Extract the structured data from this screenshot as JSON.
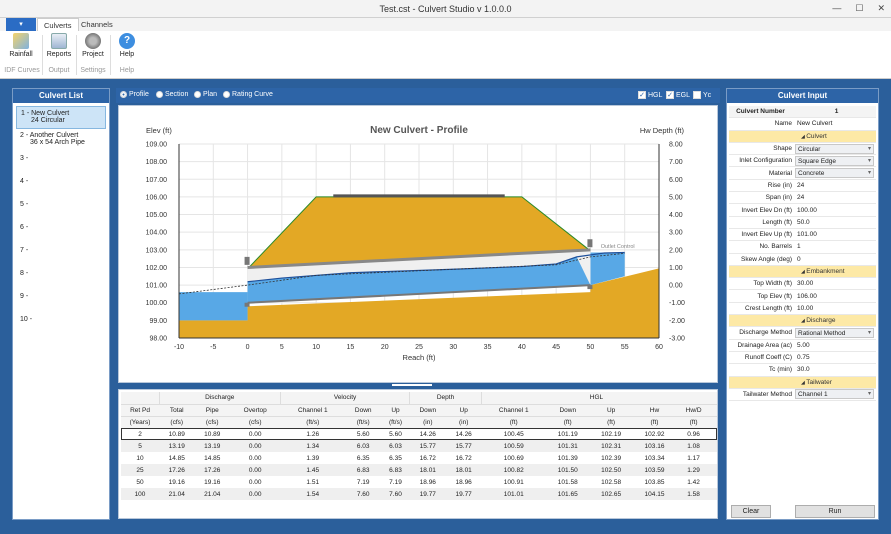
{
  "window": {
    "title": "Test.cst - Culvert Studio v 1.0.0.0"
  },
  "tabs": [
    "Culverts",
    "Channels"
  ],
  "ribbon": {
    "buttons": [
      {
        "label": "Rainfall",
        "icon": "rainfall-icon"
      },
      {
        "label": "Reports",
        "icon": "reports-icon"
      },
      {
        "label": "Project",
        "icon": "gears-icon"
      },
      {
        "label": "Help",
        "icon": "help-icon"
      }
    ],
    "groups": [
      "IDF Curves",
      "Output",
      "Settings",
      "Help"
    ]
  },
  "culvert_list": {
    "title": "Culvert List",
    "items": [
      {
        "line1": "1 - New Culvert",
        "line2": "24 Circular"
      },
      {
        "line1": "2 - Another Culvert",
        "line2": "36 x 54 Arch Pipe"
      },
      {
        "line1": "3 -",
        "line2": ""
      },
      {
        "line1": "4 -",
        "line2": ""
      },
      {
        "line1": "5 -",
        "line2": ""
      },
      {
        "line1": "6 -",
        "line2": ""
      },
      {
        "line1": "7 -",
        "line2": ""
      },
      {
        "line1": "8 -",
        "line2": ""
      },
      {
        "line1": "9 -",
        "line2": ""
      },
      {
        "line1": "10 -",
        "line2": ""
      }
    ]
  },
  "view_options": {
    "radios": [
      "Profile",
      "Section",
      "Plan",
      "Rating Curve"
    ],
    "selected": "Profile",
    "checks": [
      {
        "label": "HGL",
        "checked": true
      },
      {
        "label": "EGL",
        "checked": true
      },
      {
        "label": "Yc",
        "checked": false
      }
    ]
  },
  "chart_data": {
    "type": "area",
    "title": "New Culvert - Profile",
    "ylabel": "Elev (ft)",
    "y2label": "Hw Depth (ft)",
    "xlabel": "Reach (ft)",
    "annotation": "Outlet Control",
    "xlim": [
      -10,
      60
    ],
    "ylim": [
      98,
      109
    ],
    "y2lim": [
      -3,
      8
    ],
    "x_ticks": [
      "-10",
      "-5",
      "0",
      "5",
      "10",
      "15",
      "20",
      "25",
      "30",
      "35",
      "40",
      "45",
      "50",
      "55",
      "60"
    ],
    "y_ticks": [
      "109.00",
      "108.00",
      "107.00",
      "106.00",
      "105.00",
      "104.00",
      "103.00",
      "102.00",
      "101.00",
      "100.00",
      "99.00",
      "98.00"
    ],
    "y2_ticks": [
      "8.00",
      "7.00",
      "6.00",
      "5.00",
      "4.00",
      "3.00",
      "2.00",
      "1.00",
      "0.00",
      "-1.00",
      "-2.00",
      "-3.00"
    ],
    "embankment": {
      "x": [
        0.2,
        10,
        40,
        49.8
      ],
      "y": [
        102,
        106,
        106,
        103
      ]
    },
    "culvert_invert": {
      "x": [
        0,
        50
      ],
      "y": [
        100,
        101
      ]
    },
    "crown": {
      "x": [
        0,
        50
      ],
      "y": [
        102,
        103
      ]
    },
    "hgl": {
      "x": [
        0,
        5,
        15,
        30,
        40,
        45,
        48,
        52,
        55
      ],
      "y": [
        101.19,
        101.4,
        101.7,
        101.9,
        102.05,
        102.2,
        102.6,
        102.82,
        102.85
      ]
    },
    "egl": {
      "x": [
        -10,
        0,
        10,
        30,
        45,
        50,
        55
      ],
      "y": [
        100.5,
        101.0,
        101.55,
        101.9,
        102.15,
        102.6,
        102.8
      ]
    }
  },
  "results": {
    "groups": [
      "Discharge",
      "Velocity",
      "Depth",
      "HGL"
    ],
    "headers": [
      "Ret Pd",
      "Total",
      "Pipe",
      "Overtop",
      "Channel 1",
      "Down",
      "Up",
      "Down",
      "Up",
      "Channel 1",
      "Down",
      "Up",
      "Hw",
      "Hw/D"
    ],
    "units": [
      "(Years)",
      "(cfs)",
      "(cfs)",
      "(cfs)",
      "(ft/s)",
      "(ft/s)",
      "(ft/s)",
      "(in)",
      "(in)",
      "(ft)",
      "(ft)",
      "(ft)",
      "(ft)",
      "(ft)"
    ],
    "rows": [
      [
        "2",
        "10.89",
        "10.89",
        "0.00",
        "1.26",
        "5.60",
        "5.60",
        "14.26",
        "14.26",
        "100.45",
        "101.19",
        "102.19",
        "102.92",
        "0.96"
      ],
      [
        "5",
        "13.19",
        "13.19",
        "0.00",
        "1.34",
        "6.03",
        "6.03",
        "15.77",
        "15.77",
        "100.59",
        "101.31",
        "102.31",
        "103.16",
        "1.08"
      ],
      [
        "10",
        "14.85",
        "14.85",
        "0.00",
        "1.39",
        "6.35",
        "6.35",
        "16.72",
        "16.72",
        "100.69",
        "101.39",
        "102.39",
        "103.34",
        "1.17"
      ],
      [
        "25",
        "17.26",
        "17.26",
        "0.00",
        "1.45",
        "6.83",
        "6.83",
        "18.01",
        "18.01",
        "100.82",
        "101.50",
        "102.50",
        "103.59",
        "1.29"
      ],
      [
        "50",
        "19.16",
        "19.16",
        "0.00",
        "1.51",
        "7.19",
        "7.19",
        "18.96",
        "18.96",
        "100.91",
        "101.58",
        "102.58",
        "103.85",
        "1.42"
      ],
      [
        "100",
        "21.04",
        "21.04",
        "0.00",
        "1.54",
        "7.60",
        "7.60",
        "19.77",
        "19.77",
        "101.01",
        "101.65",
        "102.65",
        "104.15",
        "1.58"
      ]
    ]
  },
  "culvert_input": {
    "title": "Culvert Input",
    "number_label": "Culvert Number",
    "number": "1",
    "rows": [
      {
        "label": "Name",
        "value": "New Culvert"
      },
      {
        "section": "Culvert"
      },
      {
        "label": "Shape",
        "value": "Circular",
        "drop": true
      },
      {
        "label": "Inlet Configuration",
        "value": "Square Edge",
        "drop": true
      },
      {
        "label": "Material",
        "value": "Concrete",
        "drop": true
      },
      {
        "label": "Rise (in)",
        "value": "24"
      },
      {
        "label": "Span (in)",
        "value": "24"
      },
      {
        "label": "Invert Elev Dn (ft)",
        "value": "100.00"
      },
      {
        "label": "Length (ft)",
        "value": "50.0"
      },
      {
        "label": "Invert Elev Up (ft)",
        "value": "101.00"
      },
      {
        "label": "No. Barrels",
        "value": "1"
      },
      {
        "label": "Skew Angle (deg)",
        "value": "0"
      },
      {
        "section": "Embankment"
      },
      {
        "label": "Top Width (ft)",
        "value": "30.00"
      },
      {
        "label": "Top Elev (ft)",
        "value": "106.00"
      },
      {
        "label": "Crest Length (ft)",
        "value": "10.00"
      },
      {
        "section": "Discharge"
      },
      {
        "label": "Discharge Method",
        "value": "Rational Method",
        "drop": true
      },
      {
        "label": "Drainage Area (ac)",
        "value": "5.00"
      },
      {
        "label": "Runoff Coeff (C)",
        "value": "0.75"
      },
      {
        "label": "Tc (min)",
        "value": "30.0"
      },
      {
        "section": "Tailwater"
      },
      {
        "label": "Tailwater Method",
        "value": "Channel 1",
        "drop": true
      }
    ],
    "clear_label": "Clear",
    "run_label": "Run"
  },
  "colors": {
    "accent": "#2d64a7",
    "embankment": "#e3a825",
    "water": "#58a8e6",
    "ground": "#e3a825"
  }
}
